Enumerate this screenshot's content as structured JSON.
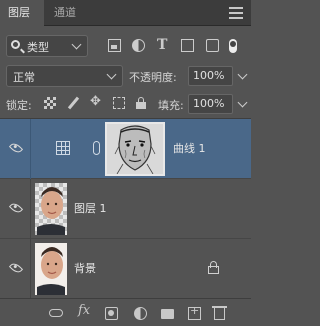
{
  "tabs": [
    {
      "label": "图层",
      "active": true
    },
    {
      "label": "通道",
      "active": false
    }
  ],
  "filter": {
    "kind_label": "类型"
  },
  "blend": {
    "mode": "正常",
    "opacity_label": "不透明度:",
    "opacity_value": "100%"
  },
  "lock": {
    "label": "锁定:",
    "fill_label": "填充:",
    "fill_value": "100%"
  },
  "layers": [
    {
      "name": "曲线 1",
      "type": "adjustment-curves",
      "visible": true,
      "selected": true,
      "linked_mask": true
    },
    {
      "name": "图层 1",
      "type": "pixel",
      "visible": true,
      "selected": false
    },
    {
      "name": "背景",
      "type": "background",
      "visible": true,
      "selected": false,
      "locked": true
    }
  ],
  "bottom_icons": [
    "link-layers-icon",
    "fx-icon",
    "add-mask-icon",
    "adjustment-layer-icon",
    "new-group-icon",
    "new-layer-icon",
    "delete-layer-icon"
  ],
  "colors": {
    "selected_row": "#4a6889",
    "panel_bg": "#535353"
  }
}
